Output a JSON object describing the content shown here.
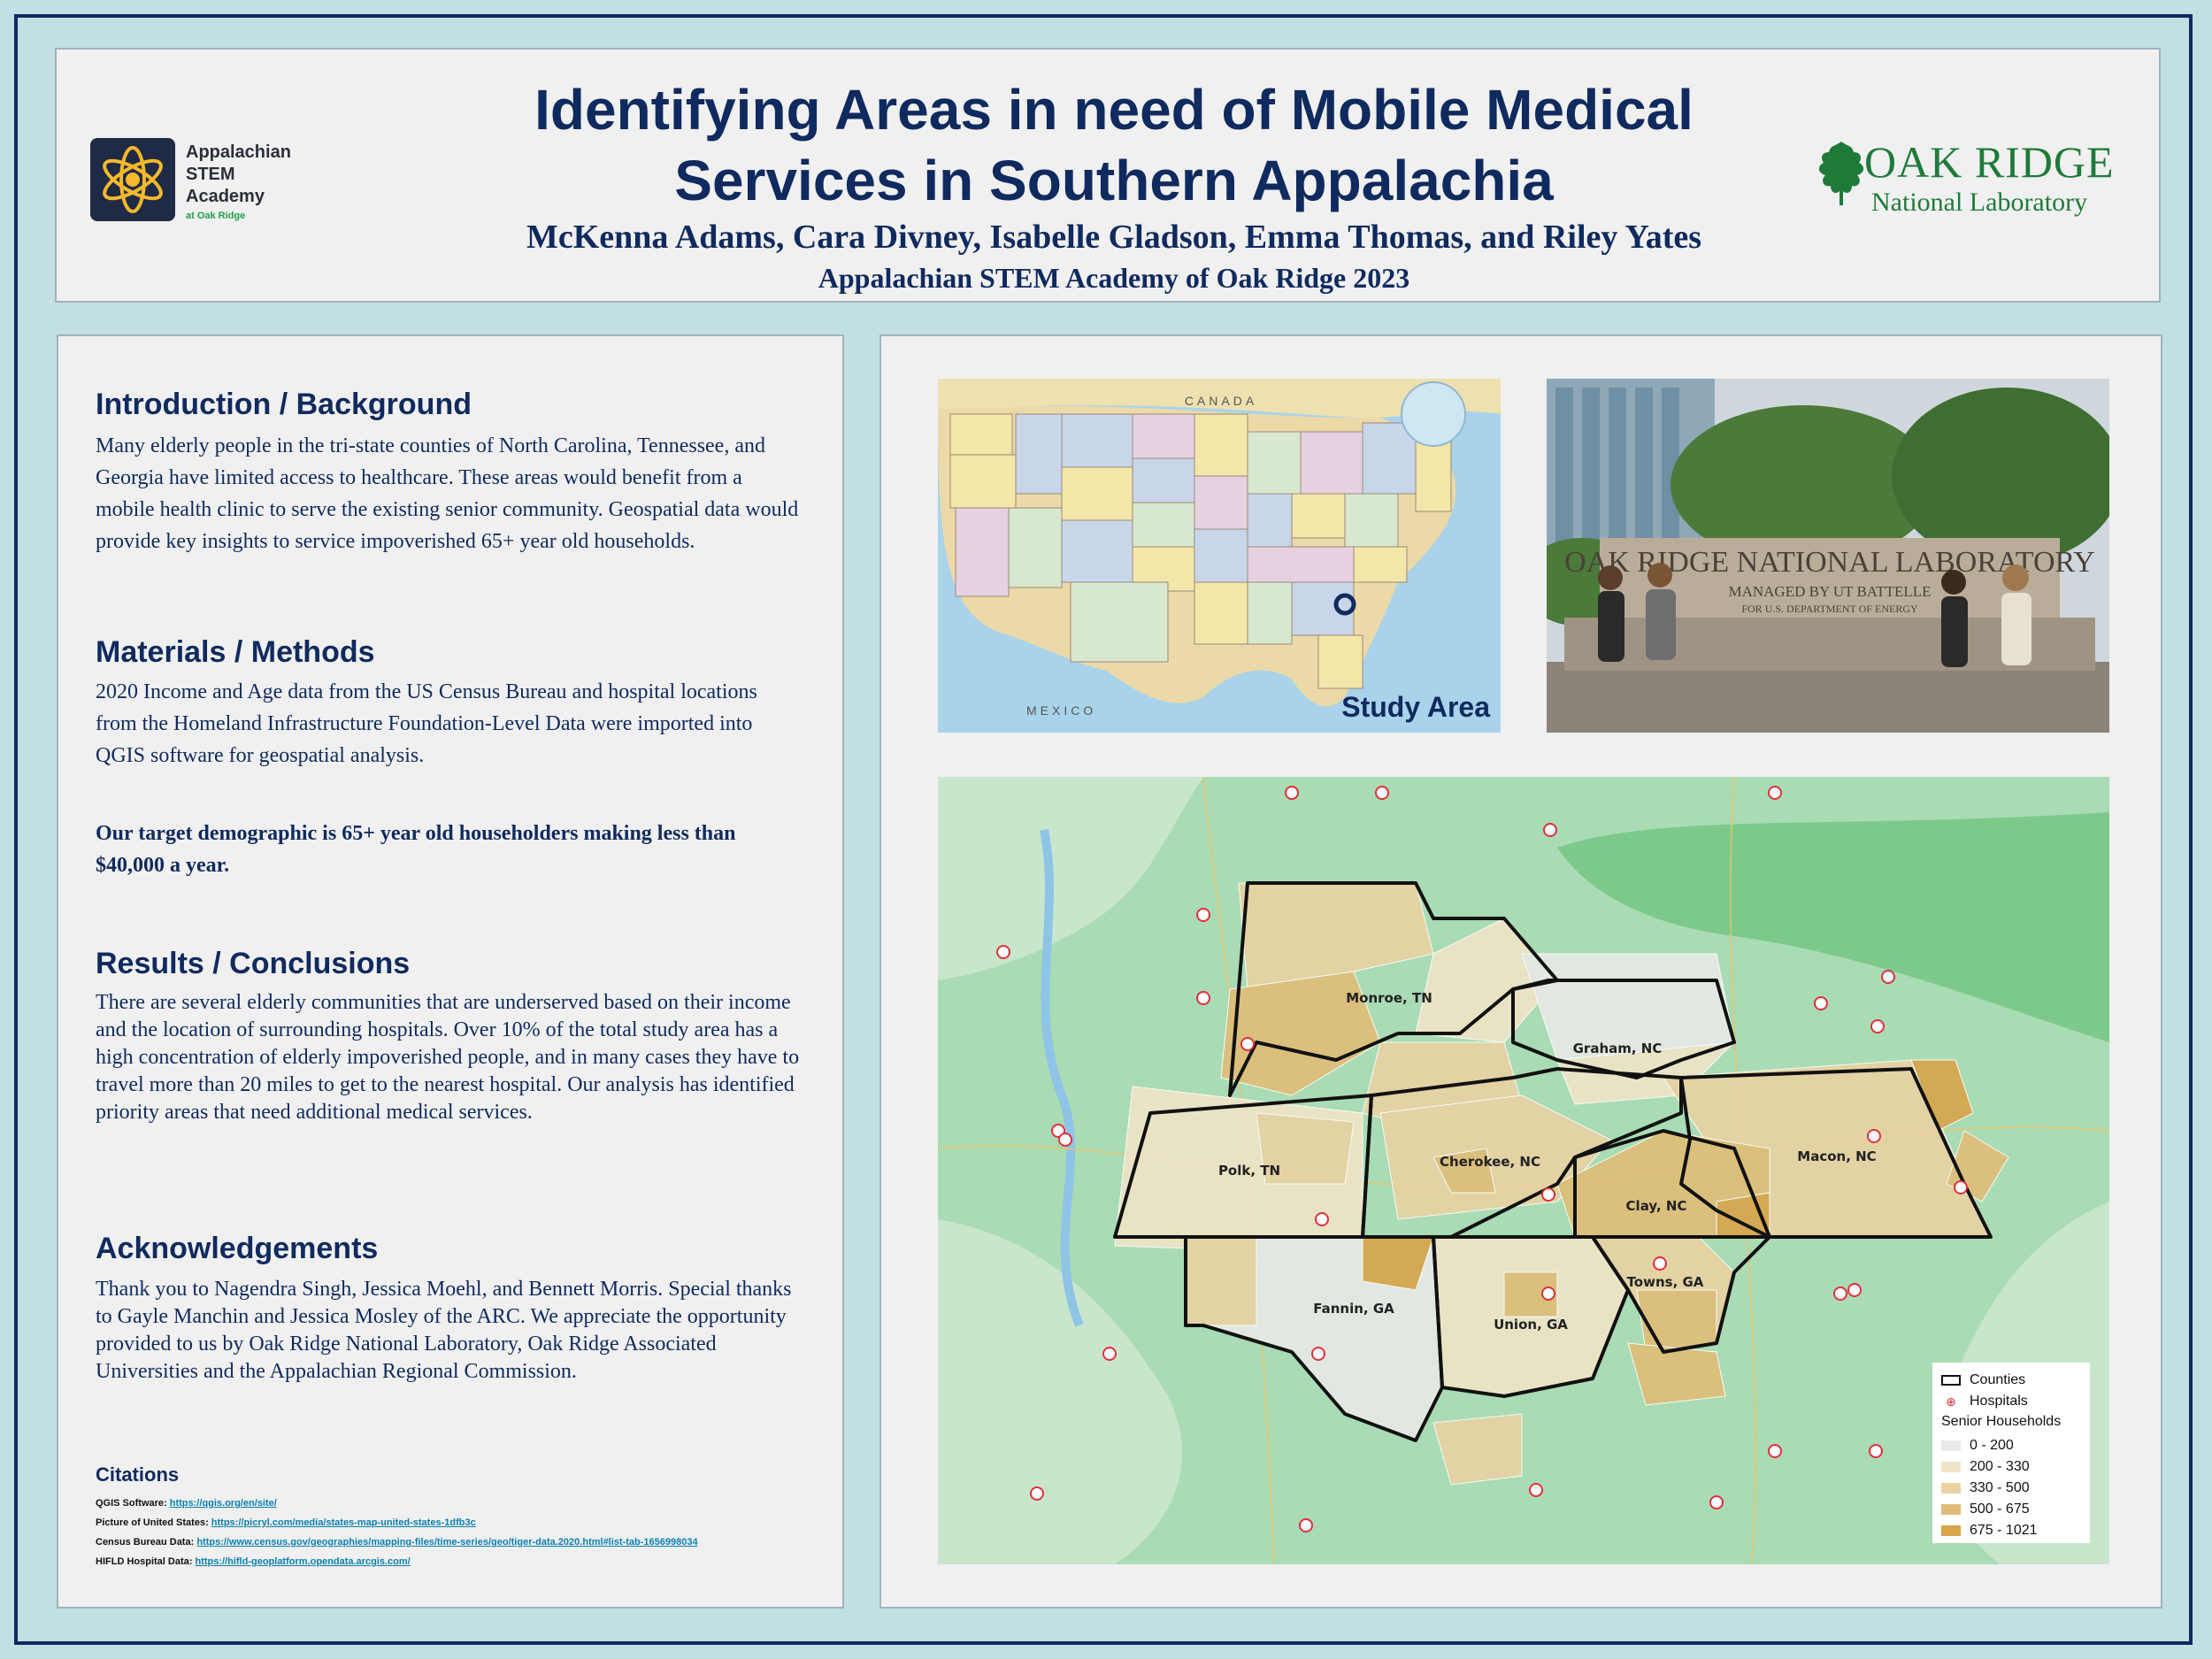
{
  "header": {
    "title_line1": "Identifying Areas in need of Mobile Medical",
    "title_line2": "Services in Southern Appalachia",
    "authors": "McKenna Adams, Cara Divney, Isabelle Gladson, Emma Thomas, and Riley Yates",
    "affiliation": "Appalachian STEM Academy of Oak Ridge 2023",
    "asa_logo": {
      "line1": "Appalachian",
      "line2": "STEM",
      "line3": "Academy",
      "sub": "at Oak Ridge"
    },
    "ornl_logo": {
      "name": "OAK RIDGE",
      "sub": "National Laboratory"
    }
  },
  "sections": {
    "intro": {
      "heading": "Introduction / Background",
      "body": "Many elderly people in the tri-state counties of North Carolina, Tennessee, and Georgia have limited access to healthcare. These areas would benefit from a mobile health clinic to serve the existing senior community. Geospatial data would provide key insights to service impoverished 65+ year old households."
    },
    "methods": {
      "heading": "Materials / Methods",
      "body": "2020 Income and Age data from the US Census Bureau and hospital locations from the Homeland Infrastructure Foundation-Level Data were imported into QGIS software for geospatial analysis.",
      "emphasis": "Our target demographic is 65+ year old householders making less than $40,000 a year."
    },
    "results": {
      "heading": "Results / Conclusions",
      "body": "There are several elderly communities that are underserved based on their income and the location of surrounding hospitals. Over 10% of the total study area has a high concentration of elderly impoverished people, and in many cases they have to travel more than 20 miles to get to the nearest hospital. Our analysis has identified priority areas that need additional medical services."
    },
    "ack": {
      "heading": "Acknowledgements",
      "body": "Thank you to Nagendra Singh, Jessica Moehl, and Bennett Morris. Special thanks to Gayle Manchin and Jessica Mosley of the ARC. We appreciate the opportunity provided to us by Oak Ridge National Laboratory, Oak Ridge Associated Universities and the Appalachian Regional Commission."
    },
    "citations": {
      "heading": "Citations",
      "items": [
        {
          "label": "QGIS Software: ",
          "link": "https://qgis.org/en/site/"
        },
        {
          "label": "Picture of United States: ",
          "link": "https://picryl.com/media/states-map-united-states-1dfb3c"
        },
        {
          "label": "Census Bureau Data: ",
          "link": "https://www.census.gov/geographies/mapping-files/time-series/geo/tiger-data.2020.html#list-tab-1656998034"
        },
        {
          "label": "HIFLD Hospital Data: ",
          "link": "https://hifld-geoplatform.opendata.arcgis.com/"
        }
      ]
    }
  },
  "us_map": {
    "label": "Study Area",
    "country_labels": {
      "north": "CANADA",
      "south": "MEXICO"
    }
  },
  "photo": {
    "sign_line1": "OAK RIDGE NATIONAL LABORATORY",
    "sign_line2": "MANAGED BY UT BATTELLE",
    "sign_line3": "FOR U.S. DEPARTMENT OF ENERGY"
  },
  "study_map": {
    "counties": {
      "monroe": "Monroe, TN",
      "graham": "Graham, NC",
      "polk": "Polk, TN",
      "cherokee": "Cherokee, NC",
      "macon": "Macon, NC",
      "clay": "Clay, NC",
      "towns": "Towns, GA",
      "fannin": "Fannin, GA",
      "union": "Union, GA"
    },
    "legend": {
      "counties": "Counties",
      "hospitals": "Hospitals",
      "title": "Senior Households",
      "classes": [
        {
          "label": "0 - 200",
          "color": "#e8eae6"
        },
        {
          "label": "200 - 330",
          "color": "#f1e4c8"
        },
        {
          "label": "330 - 500",
          "color": "#e9d2a3"
        },
        {
          "label": "500 - 675",
          "color": "#e0bd78"
        },
        {
          "label": "675 - 1021",
          "color": "#d9a44a"
        }
      ]
    }
  },
  "colors": {
    "navy": "#0f2a5e",
    "ornl_green": "#1f7a3a",
    "background": "#c2dfe3",
    "panel": "#f0f0f0"
  }
}
